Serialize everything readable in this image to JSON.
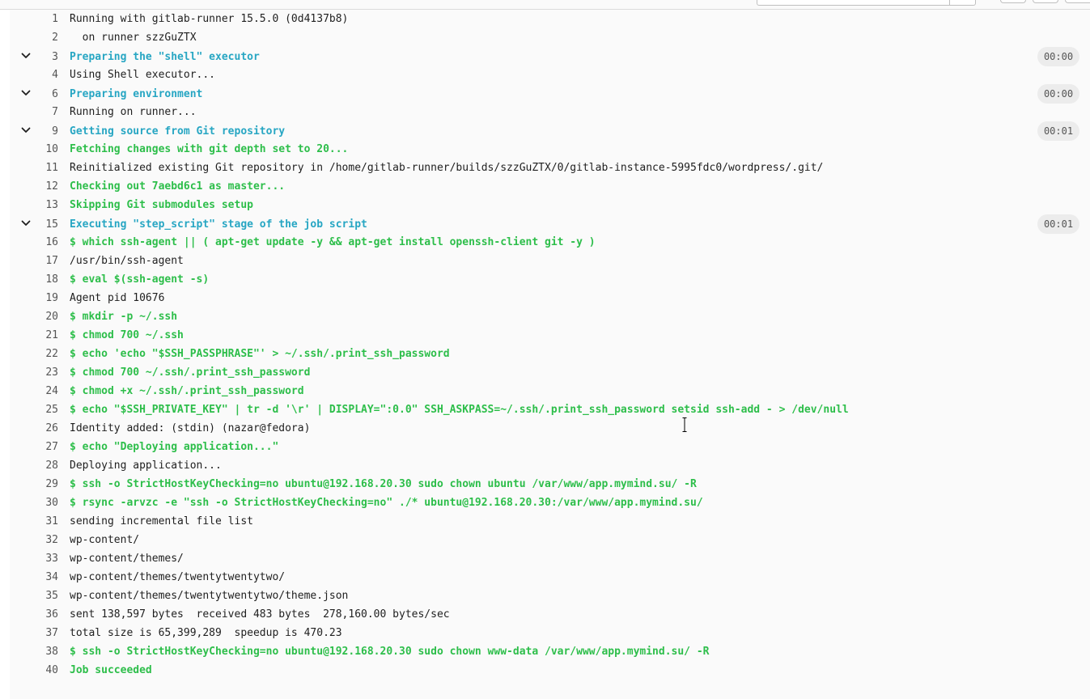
{
  "log": {
    "lines": [
      {
        "n": "1",
        "t": "Running with gitlab-runner 15.5.0 (0d4137b8)",
        "k": "plain"
      },
      {
        "n": "2",
        "t": "  on runner szzGuZTX",
        "k": "plain"
      },
      {
        "n": "3",
        "t": "Preparing the \"shell\" executor",
        "k": "section",
        "d": "00:00"
      },
      {
        "n": "4",
        "t": "Using Shell executor...",
        "k": "plain"
      },
      {
        "n": "6",
        "t": "Preparing environment",
        "k": "section",
        "d": "00:00"
      },
      {
        "n": "7",
        "t": "Running on runner...",
        "k": "plain"
      },
      {
        "n": "9",
        "t": "Getting source from Git repository",
        "k": "section",
        "d": "00:01"
      },
      {
        "n": "10",
        "t": "Fetching changes with git depth set to 20...",
        "k": "cmd"
      },
      {
        "n": "11",
        "t": "Reinitialized existing Git repository in /home/gitlab-runner/builds/szzGuZTX/0/gitlab-instance-5995fdc0/wordpress/.git/",
        "k": "plain"
      },
      {
        "n": "12",
        "t": "Checking out 7aebd6c1 as master...",
        "k": "cmd"
      },
      {
        "n": "13",
        "t": "Skipping Git submodules setup",
        "k": "cmd"
      },
      {
        "n": "15",
        "t": "Executing \"step_script\" stage of the job script",
        "k": "section",
        "d": "00:01"
      },
      {
        "n": "16",
        "t": "$ which ssh-agent || ( apt-get update -y && apt-get install openssh-client git -y )",
        "k": "cmd"
      },
      {
        "n": "17",
        "t": "/usr/bin/ssh-agent",
        "k": "plain"
      },
      {
        "n": "18",
        "t": "$ eval $(ssh-agent -s)",
        "k": "cmd"
      },
      {
        "n": "19",
        "t": "Agent pid 10676",
        "k": "plain"
      },
      {
        "n": "20",
        "t": "$ mkdir -p ~/.ssh",
        "k": "cmd"
      },
      {
        "n": "21",
        "t": "$ chmod 700 ~/.ssh",
        "k": "cmd"
      },
      {
        "n": "22",
        "t": "$ echo 'echo \"$SSH_PASSPHRASE\"' > ~/.ssh/.print_ssh_password",
        "k": "cmd"
      },
      {
        "n": "23",
        "t": "$ chmod 700 ~/.ssh/.print_ssh_password",
        "k": "cmd"
      },
      {
        "n": "24",
        "t": "$ chmod +x ~/.ssh/.print_ssh_password",
        "k": "cmd"
      },
      {
        "n": "25",
        "t": "$ echo \"$SSH_PRIVATE_KEY\" | tr -d '\\r' | DISPLAY=\":0.0\" SSH_ASKPASS=~/.ssh/.print_ssh_password setsid ssh-add - > /dev/null",
        "k": "cmd"
      },
      {
        "n": "26",
        "t": "Identity added: (stdin) (nazar@fedora)",
        "k": "plain"
      },
      {
        "n": "27",
        "t": "$ echo \"Deploying application...\"",
        "k": "cmd"
      },
      {
        "n": "28",
        "t": "Deploying application...",
        "k": "plain"
      },
      {
        "n": "29",
        "t": "$ ssh -o StrictHostKeyChecking=no ubuntu@192.168.20.30 sudo chown ubuntu /var/www/app.mymind.su/ -R",
        "k": "cmd"
      },
      {
        "n": "30",
        "t": "$ rsync -arvzc -e \"ssh -o StrictHostKeyChecking=no\" ./* ubuntu@192.168.20.30:/var/www/app.mymind.su/",
        "k": "cmd"
      },
      {
        "n": "31",
        "t": "sending incremental file list",
        "k": "plain"
      },
      {
        "n": "32",
        "t": "wp-content/",
        "k": "plain"
      },
      {
        "n": "33",
        "t": "wp-content/themes/",
        "k": "plain"
      },
      {
        "n": "34",
        "t": "wp-content/themes/twentytwentytwo/",
        "k": "plain"
      },
      {
        "n": "35",
        "t": "wp-content/themes/twentytwentytwo/theme.json",
        "k": "plain"
      },
      {
        "n": "36",
        "t": "sent 138,597 bytes  received 483 bytes  278,160.00 bytes/sec",
        "k": "plain"
      },
      {
        "n": "37",
        "t": "total size is 65,399,289  speedup is 470.23",
        "k": "plain"
      },
      {
        "n": "38",
        "t": "$ ssh -o StrictHostKeyChecking=no ubuntu@192.168.20.30 sudo chown www-data /var/www/app.mymind.su/ -R",
        "k": "cmd"
      },
      {
        "n": "40",
        "t": "Job succeeded",
        "k": "cmd"
      }
    ]
  },
  "icons": {
    "section_toggle": "chevron-down-icon",
    "cursor": "text-cursor-icon"
  },
  "colors": {
    "command": "#2dbe4a",
    "section_header": "#27a6c3",
    "plain": "#1f1f1f",
    "line_number": "#555555",
    "log_background": "#fafafa"
  }
}
